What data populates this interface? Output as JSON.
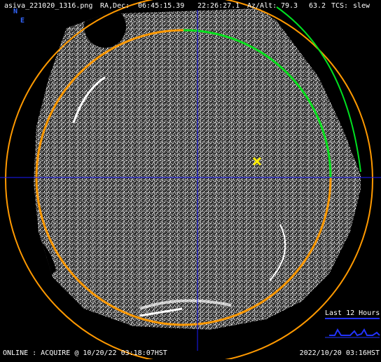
{
  "header": {
    "filename": "asiva_221020_1316.png",
    "radec_label": "RA,Dec:",
    "ra": "06:45:15.39",
    "dec": "22:26:27.1",
    "azalt_label": "Az/Alt:",
    "az": "79.3",
    "alt": "63.2",
    "tcs_label": "TCS:",
    "tcs_state": "slew"
  },
  "compass": {
    "north": "N",
    "east": "E"
  },
  "history": {
    "title": "Last 12 Hours"
  },
  "footer": {
    "status": "ONLINE : ACQUIRE @ 10/20/22 03:18:07HST",
    "timestamp": "2022/10/20 03:16HST"
  },
  "colors": {
    "crosshair": "#1a1aff",
    "fov_ring": "#ff9900",
    "dome_arc": "#00e020",
    "target_marker": "#ffee00",
    "history_line": "#2233ff"
  }
}
